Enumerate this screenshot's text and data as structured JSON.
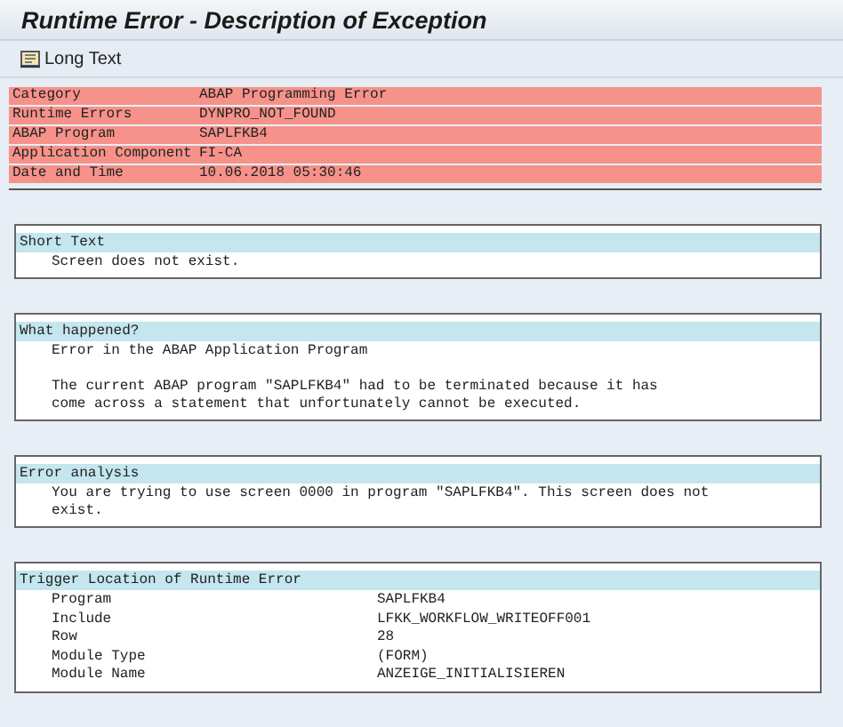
{
  "window": {
    "title": "Runtime Error - Description of Exception"
  },
  "toolbar": {
    "buttons": [
      {
        "label": "Long Text"
      }
    ]
  },
  "header_table": {
    "rows": [
      {
        "label": "Category",
        "value": "ABAP Programming Error"
      },
      {
        "label": "Runtime Errors",
        "value": "DYNPRO_NOT_FOUND"
      },
      {
        "label": "ABAP Program",
        "value": "SAPLFKB4"
      },
      {
        "label": "Application Component",
        "value": "FI-CA"
      },
      {
        "label": "Date and Time",
        "value": "10.06.2018 05:30:46"
      }
    ]
  },
  "sections": [
    {
      "kind": "text",
      "title": "Short Text",
      "paragraphs": [
        [
          "Screen does not exist."
        ]
      ]
    },
    {
      "kind": "text",
      "title": "What happened?",
      "paragraphs": [
        [
          "Error in the ABAP Application Program"
        ],
        [
          "The current ABAP program \"SAPLFKB4\" had to be terminated because it has",
          "come across a statement that unfortunately cannot be executed."
        ]
      ]
    },
    {
      "kind": "text",
      "title": "Error analysis",
      "paragraphs": [
        [
          "You are trying to use screen 0000 in program \"SAPLFKB4\". This screen does not",
          "exist."
        ]
      ]
    },
    {
      "kind": "fields",
      "title": "Trigger Location of Runtime Error",
      "fields": [
        {
          "label": "Program",
          "value": "SAPLFKB4"
        },
        {
          "label": "Include",
          "value": "LFKK_WORKFLOW_WRITEOFF001"
        },
        {
          "label": "Row",
          "value": "28"
        },
        {
          "label": "Module Type",
          "value": "(FORM)"
        },
        {
          "label": "Module Name",
          "value": "ANZEIGE_INITIALISIEREN"
        }
      ]
    }
  ]
}
